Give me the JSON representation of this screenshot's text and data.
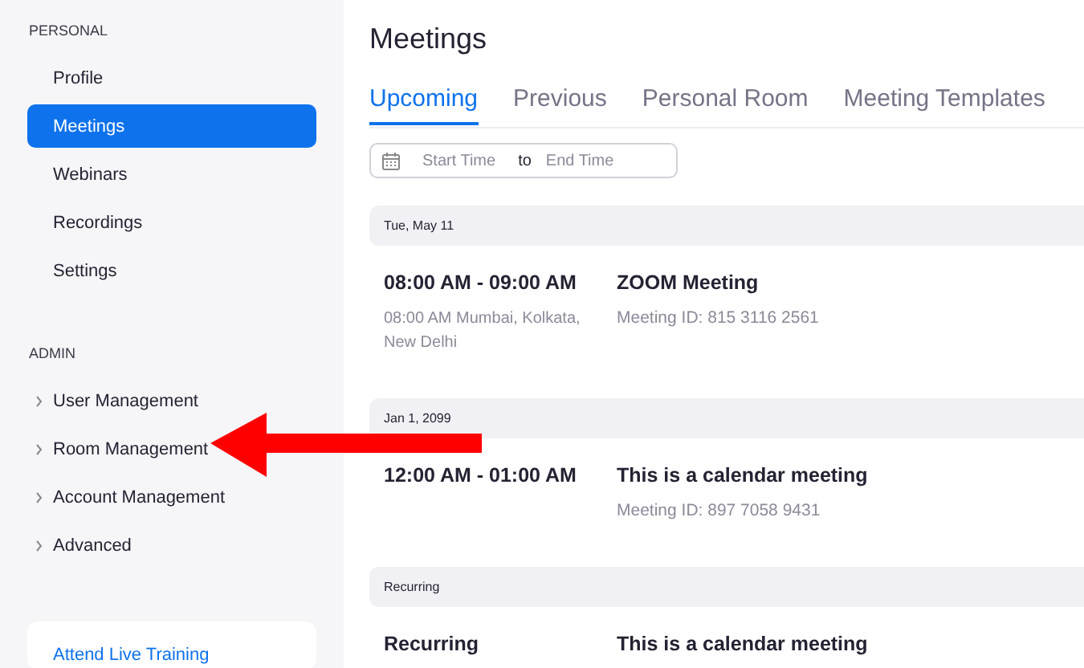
{
  "sidebar": {
    "sections": [
      {
        "heading": "PERSONAL",
        "items": [
          {
            "label": "Profile",
            "selected": false
          },
          {
            "label": "Meetings",
            "selected": true
          },
          {
            "label": "Webinars",
            "selected": false
          },
          {
            "label": "Recordings",
            "selected": false
          },
          {
            "label": "Settings",
            "selected": false
          }
        ]
      },
      {
        "heading": "ADMIN",
        "items": [
          {
            "label": "User Management",
            "selected": false,
            "expanded": false
          },
          {
            "label": "Room Management",
            "selected": false,
            "expanded": false
          },
          {
            "label": "Account Management",
            "selected": false,
            "expanded": false
          },
          {
            "label": "Advanced",
            "selected": false,
            "expanded": false
          }
        ]
      }
    ],
    "card": {
      "link": "Attend Live Training"
    }
  },
  "main": {
    "title": "Meetings",
    "tabs": [
      {
        "label": "Upcoming",
        "selected": true
      },
      {
        "label": "Previous",
        "selected": false
      },
      {
        "label": "Personal Room",
        "selected": false
      },
      {
        "label": "Meeting Templates",
        "selected": false
      }
    ],
    "date_range": {
      "start_placeholder": "Start Time",
      "separator": "to",
      "end_placeholder": "End Time"
    },
    "groups": [
      {
        "date": "Tue, May 11",
        "meetings": [
          {
            "time": "08:00 AM - 09:00 AM",
            "timezone": "08:00 AM Mumbai, Kolkata, New Delhi",
            "topic": "ZOOM Meeting",
            "meeting_id": "Meeting ID: 815 3116 2561"
          }
        ]
      },
      {
        "date": "Jan 1, 2099",
        "meetings": [
          {
            "time": "12:00 AM - 01:00 AM",
            "topic": "This is a calendar meeting",
            "meeting_id": "Meeting ID: 897 7058 9431"
          }
        ]
      },
      {
        "date": "Recurring",
        "meetings": [
          {
            "time": "Recurring",
            "topic": "This is a calendar meeting"
          }
        ]
      }
    ]
  },
  "annotations": [
    {
      "kind": "arrow"
    }
  ]
}
